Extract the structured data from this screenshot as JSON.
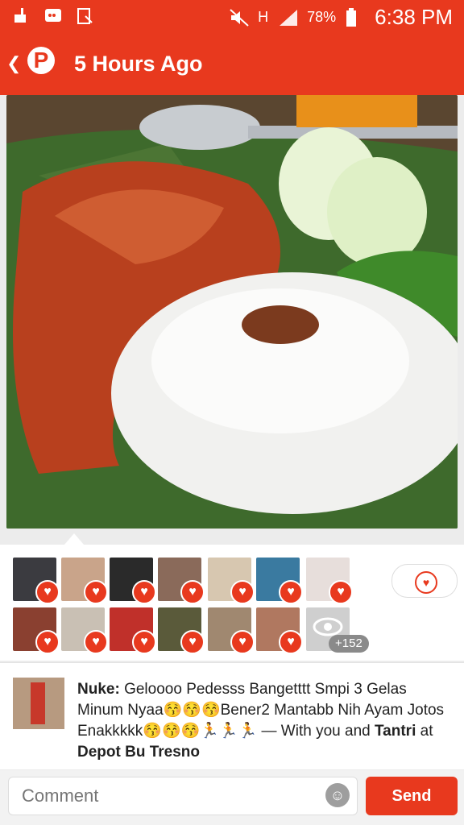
{
  "status_bar": {
    "signal_label": "H",
    "battery_percent": "78%",
    "time": "6:38 PM"
  },
  "app_bar": {
    "back_icon": "chevron-left-icon",
    "logo_letter": "P",
    "title": "5 Hours Ago",
    "color": "#e8391e"
  },
  "photo": {
    "description_icon": "food-photo"
  },
  "likes": {
    "avatar_count_shown": 13,
    "more_count": "+152",
    "heart_icon": "heart-icon"
  },
  "post": {
    "author": "Nuke:",
    "text_main": " Geloooo Pedesss Banget​ttt Smpi 3 Gelas Minum Nyaa😚😚😚Bener2 Mantabb Nih Ayam Jotos Enakkkkk😚😚😚🏃🏃🏃 — With you and ",
    "tagged": "Tantri",
    "at_word": " at ",
    "place": "Depot Bu Tresno"
  },
  "composer": {
    "placeholder": "Comment",
    "send_label": "Send"
  }
}
